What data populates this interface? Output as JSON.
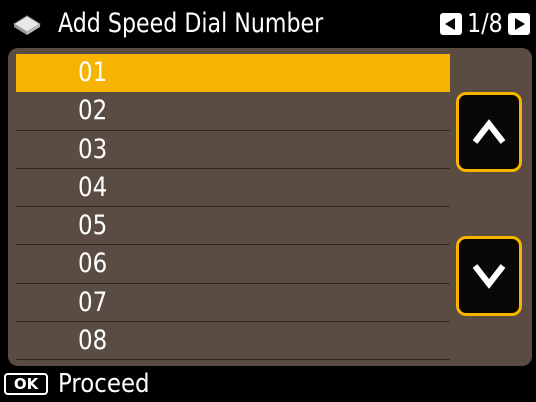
{
  "header": {
    "title": "Add Speed Dial Number",
    "icon": "phonebook-icon",
    "page_indicator": "1/8"
  },
  "list": {
    "selected_index": 0,
    "items": [
      {
        "label": "01"
      },
      {
        "label": "02"
      },
      {
        "label": "03"
      },
      {
        "label": "04"
      },
      {
        "label": "05"
      },
      {
        "label": "06"
      },
      {
        "label": "07"
      },
      {
        "label": "08"
      }
    ]
  },
  "scroll": {
    "up_icon": "chevron-up-icon",
    "down_icon": "chevron-down-icon"
  },
  "footer": {
    "ok_key": "OK",
    "action_label": "Proceed"
  },
  "colors": {
    "highlight": "#f6b400",
    "panel": "#5a4b43",
    "background": "#000000"
  }
}
